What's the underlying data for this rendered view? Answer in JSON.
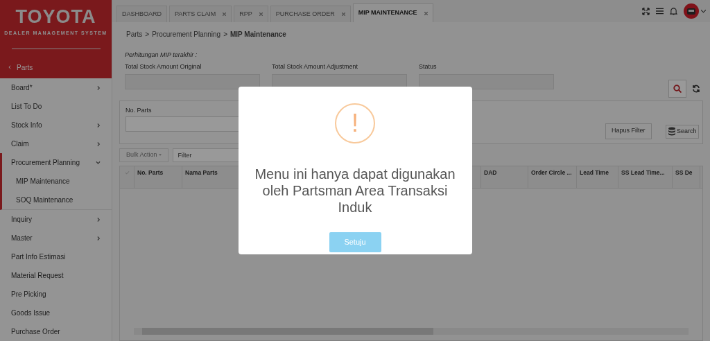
{
  "sidebar": {
    "logo": "TOYOTA",
    "subtitle": "DEALER MANAGEMENT SYSTEM",
    "back_label": "Parts",
    "items": [
      {
        "label": "Board*",
        "expanded": false
      },
      {
        "label": "List To Do"
      },
      {
        "label": "Stock Info",
        "expanded": false
      },
      {
        "label": "Claim",
        "expanded": false
      },
      {
        "label": "Procurement Planning",
        "expanded": true,
        "children": [
          {
            "label": "MIP Maintenance"
          },
          {
            "label": "SOQ Maintenance"
          }
        ]
      },
      {
        "label": "Inquiry",
        "expanded": false
      },
      {
        "label": "Master",
        "expanded": false
      },
      {
        "label": "Part Info Estimasi"
      },
      {
        "label": "Material Request"
      },
      {
        "label": "Pre Picking"
      },
      {
        "label": "Goods Issue"
      },
      {
        "label": "Purchase Order"
      }
    ]
  },
  "tabs": [
    {
      "label": "DASHBOARD",
      "closable": false,
      "selected": false
    },
    {
      "label": "PARTS CLAIM",
      "closable": true,
      "selected": false
    },
    {
      "label": "RPP",
      "closable": true,
      "selected": false
    },
    {
      "label": "PURCHASE ORDER",
      "closable": true,
      "selected": false
    },
    {
      "label": "MIP MAINTENANCE",
      "closable": true,
      "selected": true
    }
  ],
  "breadcrumb": {
    "separator": ">",
    "items": [
      {
        "label": "Parts",
        "current": false
      },
      {
        "label": "Procurement Planning",
        "current": false
      },
      {
        "label": "MIP Maintenance",
        "current": true
      }
    ]
  },
  "summary": {
    "caption": "Perhitungan MIP terakhir :",
    "fields": [
      {
        "label": "Total Stock Amount Original"
      },
      {
        "label": "Total Stock Amount Adjustment"
      },
      {
        "label": "Status"
      }
    ]
  },
  "filter": {
    "field_label": "No. Parts",
    "clear_button": "Hapus Filter",
    "search_button": "Search"
  },
  "toolbar": {
    "bulk_action": "Bulk Action",
    "filter_placeholder": "Filter"
  },
  "table": {
    "columns": [
      "No. Parts",
      "Nama Parts",
      "DAD",
      "Order Circle ...",
      "Lead Time",
      "SS Lead Time...",
      "SS De"
    ]
  },
  "modal": {
    "message": "Menu ini hanya dapat digunakan oleh Partsman Area Transaksi Induk",
    "icon": "!",
    "button": "Setuju"
  }
}
